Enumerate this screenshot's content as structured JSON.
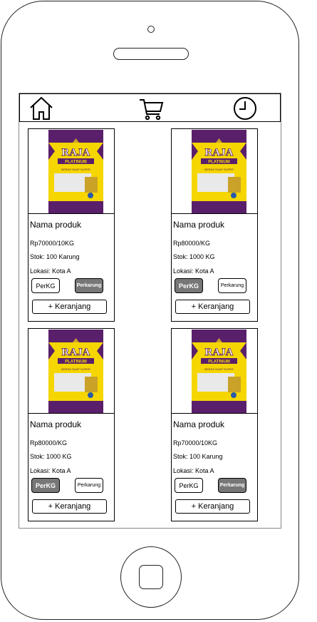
{
  "nav": {
    "icons": [
      "home-icon",
      "cart-icon",
      "clock-icon"
    ]
  },
  "colors": {
    "active_option": "#777777",
    "bag_yellow": "#f5d600",
    "bag_purple": "#5a1f6b",
    "bag_rice": "#e9e9e9",
    "bag_gold": "#c9a227"
  },
  "products": [
    {
      "image_brand": "RAJA",
      "image_sub": "PLATINUM",
      "image_tagline": "BERAS SUAP SUPER",
      "name": "Nama produk",
      "price": "Rp70000/10KG",
      "stock": "Stok: 100 Karung",
      "location": "Lokasi: Kota A",
      "option_kg": "PerKG",
      "option_karung": "Perkarung",
      "selected": "Perkarung",
      "cart_label": "+ Keranjang"
    },
    {
      "image_brand": "RAJA",
      "image_sub": "PLATINUM",
      "image_tagline": "BERAS SUAP SUPER",
      "name": "Nama produk",
      "price": "Rp80000/KG",
      "stock": "Stok: 1000 KG",
      "location": "Lokasi: Kota A",
      "option_kg": "PerKG",
      "option_karung": "Perkarung",
      "selected": "PerKG",
      "cart_label": "+ Keranjang"
    },
    {
      "image_brand": "RAJA",
      "image_sub": "PLATINUM",
      "image_tagline": "BERAS SUAP SUPER",
      "name": "Nama produk",
      "price": "Rp80000/KG",
      "stock": "Stok: 1000 KG",
      "location": "Lokasi: Kota A",
      "option_kg": "PerKG",
      "option_karung": "Perkarung",
      "selected": "PerKG",
      "cart_label": "+ Keranjang"
    },
    {
      "image_brand": "RAJA",
      "image_sub": "PLATINUM",
      "image_tagline": "BERAS SUAP SUPER",
      "name": "Nama produk",
      "price": "Rp70000/10KG",
      "stock": "Stok: 100 Karung",
      "location": "Lokasi: Kota A",
      "option_kg": "PerKG",
      "option_karung": "Perkarung",
      "selected": "Perkarung",
      "cart_label": "+ Keranjang"
    }
  ]
}
